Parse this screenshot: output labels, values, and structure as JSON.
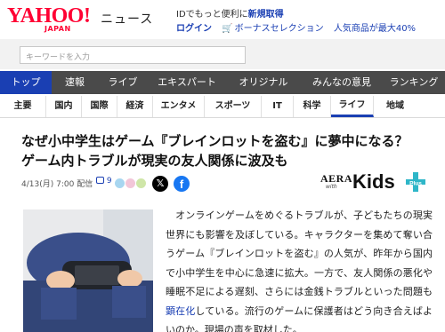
{
  "header": {
    "logo_main": "YAHOO!",
    "logo_sub": "JAPAN",
    "logo_news": "ニュース",
    "promo_text": "IDでもっと便利に",
    "promo_strong": "新規取得",
    "login": "ログイン",
    "bonus": "ボーナスセレクション",
    "hot": "人気商品が最大40%"
  },
  "search": {
    "placeholder": "キーワードを入力"
  },
  "main_nav": [
    {
      "label": "トップ",
      "active": true
    },
    {
      "label": "速報"
    },
    {
      "label": "ライブ"
    },
    {
      "label": "エキスパート"
    },
    {
      "label": "オリジナル"
    },
    {
      "label": "みんなの意見"
    },
    {
      "label": "ランキング"
    }
  ],
  "sub_nav": [
    {
      "label": "主要"
    },
    {
      "label": "国内"
    },
    {
      "label": "国際"
    },
    {
      "label": "経済"
    },
    {
      "label": "エンタメ"
    },
    {
      "label": "スポーツ"
    },
    {
      "label": "IT"
    },
    {
      "label": "科学"
    },
    {
      "label": "ライフ",
      "active": true
    },
    {
      "label": "地域"
    }
  ],
  "article": {
    "headline_line1": "なぜ小中学生はゲーム『ブレインロットを盗む』に夢中になる？",
    "headline_line2": "ゲーム内トラブルが現実の友人関係に波及も",
    "date": "4/13(月) 7:00",
    "distribution": "配信",
    "comment_count": "9",
    "source_logo_top": "AERA",
    "source_logo_with": "with",
    "source_logo_main": "Kids",
    "source_logo_plus": "Plus",
    "body_before": "　オンラインゲームをめぐるトラブルが、子どもたちの現実世界にも影響を及ぼしている。キャラクターを集めて奪い合うゲーム『ブレインロットを盗む』の人気が、昨年から国内で小中学生を中心に急速に拡大。一方で、友人関係の悪化や睡眠不足による遅刻、さらには金銭トラブルといった問題も",
    "body_link": "顕在化",
    "body_after": "している。流行のゲームに保護者はどう向き合えばよいのか。現場の声を取材した。"
  },
  "colors": {
    "brand_red": "#ff0033",
    "link_blue": "#1a3fb3",
    "nav_bg": "#4a4a4a",
    "nav_active": "#1a3fb3"
  }
}
